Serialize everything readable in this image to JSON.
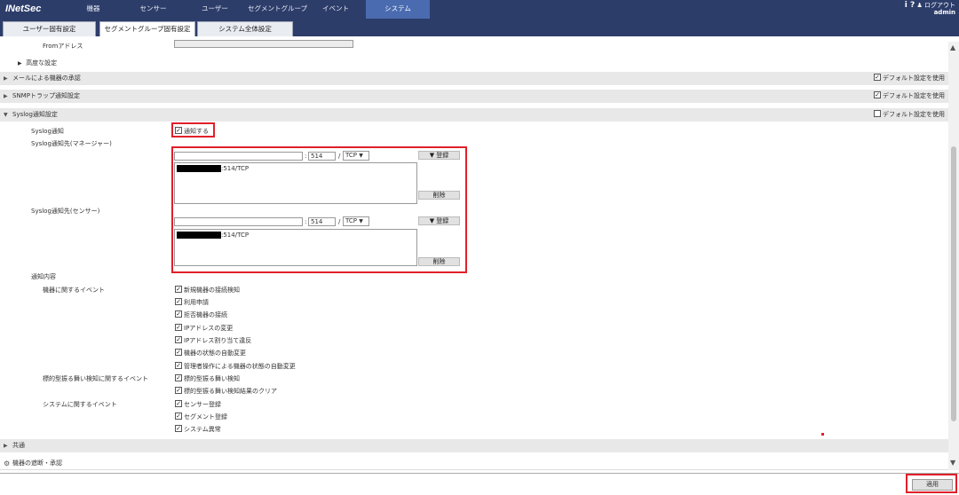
{
  "app": {
    "logo": "INetSec",
    "help": "i ?",
    "logout": "ログアウト",
    "user": "admin"
  },
  "nav": [
    {
      "label": "機器"
    },
    {
      "label": "センサー"
    },
    {
      "label": "ユーザー"
    },
    {
      "label": "セグメントグループ"
    },
    {
      "label": "イベント"
    },
    {
      "label": "システム"
    }
  ],
  "subtabs": [
    {
      "label": "ユーザー固有設定"
    },
    {
      "label": "セグメントグループ固有設定"
    },
    {
      "label": "システム全体設定"
    }
  ],
  "from_label": "Fromアドレス",
  "advanced": "高度な設定",
  "sections": {
    "mail": "メールによる機器の承認",
    "snmp": "SNMPトラップ通知設定",
    "syslog": "Syslog通知設定",
    "common": "共通",
    "block": "機器の遮断・承認"
  },
  "use_default": "デフォルト設定を使用",
  "syslog": {
    "notify_label": "Syslog通知",
    "notify_cb": "通知する",
    "manager_label": "Syslog通知先(マネージャー)",
    "sensor_label": "Syslog通知先(センサー)",
    "port": "514",
    "slash": "/",
    "colon": ":",
    "protocol": "TCP",
    "register": "▼ 登録",
    "delete": "削除",
    "entry_suffix": ":514/TCP"
  },
  "content": {
    "title": "通知内容",
    "device_events": "機器に関するイベント",
    "threat_events": "標的型振る舞い検知に関するイベント",
    "system_events": "システムに関するイベント",
    "device_items": [
      "新規機器の接続検知",
      "利用申請",
      "拒否機器の接続",
      "IPアドレスの変更",
      "IPアドレス割り当て違反",
      "機器の状態の自動変更",
      "管理者操作による機器の状態の自動変更"
    ],
    "threat_items": [
      "標的型振る舞い検知",
      "標的型振る舞い検知結果のクリア"
    ],
    "system_items": [
      "センサー登録",
      "セグメント登録",
      "システム異常"
    ]
  },
  "apply": "適用"
}
